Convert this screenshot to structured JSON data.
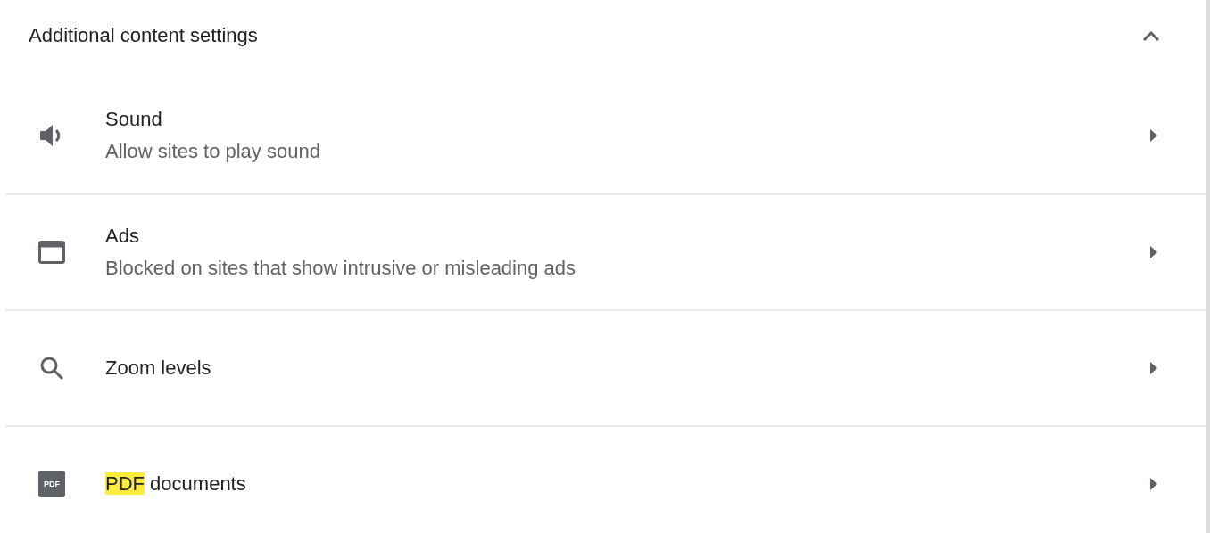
{
  "section": {
    "title": "Additional content settings",
    "expanded": true
  },
  "rows": [
    {
      "kind": "sound",
      "title_parts": [
        {
          "text": "Sound",
          "highlighted": false
        }
      ],
      "description": "Allow sites to play sound"
    },
    {
      "kind": "ads",
      "title_parts": [
        {
          "text": "Ads",
          "highlighted": false
        }
      ],
      "description": "Blocked on sites that show intrusive or misleading ads"
    },
    {
      "kind": "zoom",
      "title_parts": [
        {
          "text": "Zoom levels",
          "highlighted": false
        }
      ]
    },
    {
      "kind": "pdf",
      "icon_text": "PDF",
      "title_parts": [
        {
          "text": "PDF",
          "highlighted": true
        },
        {
          "text": " documents",
          "highlighted": false
        }
      ]
    }
  ]
}
